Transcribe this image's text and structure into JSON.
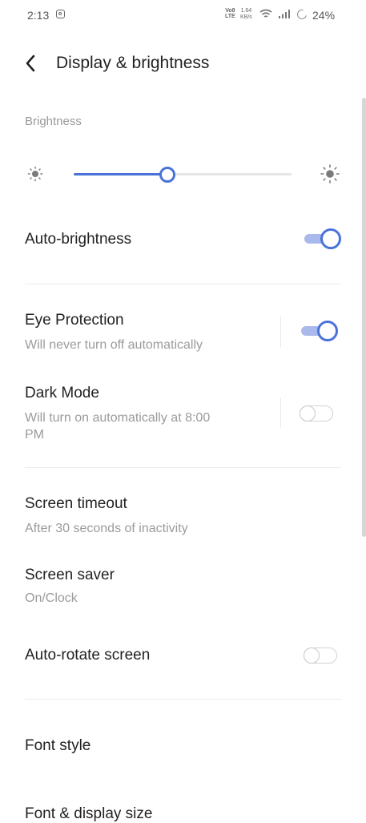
{
  "status_bar": {
    "time": "2:13",
    "volte": "Vo8\nLTE",
    "speed": "1.64\nKB/s",
    "battery": "24%"
  },
  "header": {
    "title": "Display & brightness"
  },
  "brightness": {
    "label": "Brightness",
    "level": 0.43
  },
  "settings": {
    "auto_brightness": {
      "title": "Auto-brightness",
      "on": true
    },
    "eye_protection": {
      "title": "Eye Protection",
      "subtitle": "Will never turn off automatically",
      "on": true
    },
    "dark_mode": {
      "title": "Dark Mode",
      "subtitle_line1": "Will turn on automatically at 8:00",
      "subtitle_line2": "PM",
      "on": false
    },
    "screen_timeout": {
      "title": "Screen timeout",
      "subtitle": "After 30 seconds of inactivity"
    },
    "screen_saver": {
      "title": "Screen saver",
      "subtitle": "On/Clock"
    },
    "auto_rotate": {
      "title": "Auto-rotate screen",
      "on": false
    },
    "font_style": {
      "title": "Font style"
    },
    "font_display_size": {
      "title": "Font & display size"
    }
  },
  "colors": {
    "accent": "#4a73d8",
    "accent_light": "#aab9ec"
  }
}
